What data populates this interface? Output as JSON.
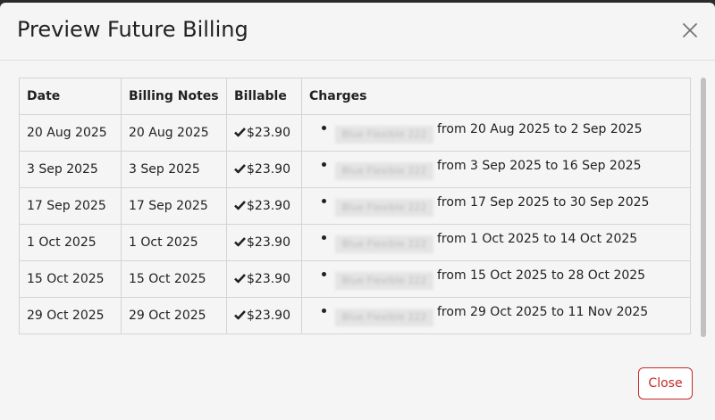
{
  "dialog": {
    "title": "Preview Future Billing",
    "close_label": "Close"
  },
  "table": {
    "headers": [
      "Date",
      "Billing Notes",
      "Billable",
      "Charges"
    ],
    "rows": [
      {
        "date": "20 Aug 2025",
        "notes": "20 Aug 2025",
        "billable": "$23.90",
        "charge_item": "Blue Flexible 222",
        "charge_period": "from 20 Aug 2025 to 2 Sep 2025"
      },
      {
        "date": "3 Sep 2025",
        "notes": "3 Sep 2025",
        "billable": "$23.90",
        "charge_item": "Blue Flexible 222",
        "charge_period": "from 3 Sep 2025 to 16 Sep 2025"
      },
      {
        "date": "17 Sep 2025",
        "notes": "17 Sep 2025",
        "billable": "$23.90",
        "charge_item": "Blue Flexible 222",
        "charge_period": "from 17 Sep 2025 to 30 Sep 2025"
      },
      {
        "date": "1 Oct 2025",
        "notes": "1 Oct 2025",
        "billable": "$23.90",
        "charge_item": "Blue Flexible 222",
        "charge_period": "from 1 Oct 2025 to 14 Oct 2025"
      },
      {
        "date": "15 Oct 2025",
        "notes": "15 Oct 2025",
        "billable": "$23.90",
        "charge_item": "Blue Flexible 222",
        "charge_period": "from 15 Oct 2025 to 28 Oct 2025"
      },
      {
        "date": "29 Oct 2025",
        "notes": "29 Oct 2025",
        "billable": "$23.90",
        "charge_item": "Blue Flexible 222",
        "charge_period": "from 29 Oct 2025 to 11 Nov 2025"
      }
    ]
  },
  "icons": {
    "close": "close-icon",
    "billable": "checkmark-icon"
  },
  "colors": {
    "close_button": "#c62828",
    "dialog_background": "#f5f5f5"
  }
}
